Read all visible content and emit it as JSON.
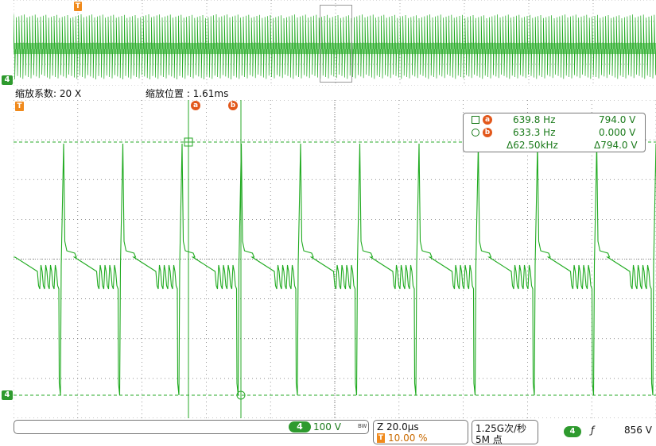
{
  "overview": {
    "channel_marker": "4",
    "trigger_marker": "T"
  },
  "zoom_info": {
    "zoom_factor_label": "缩放系数: 20 X",
    "zoom_position_label": "缩放位置 : 1.61ms"
  },
  "main_plot": {
    "channel_marker": "4",
    "trigger_marker": "T",
    "cursor_a_label": "a",
    "cursor_b_label": "b"
  },
  "readout": {
    "cursor_a": {
      "badge": "a",
      "freq": "639.8 Hz",
      "volt": "794.0 V"
    },
    "cursor_b": {
      "badge": "b",
      "freq": "633.3 Hz",
      "volt": "0.000 V"
    },
    "delta": {
      "freq": "Δ62.50kHz",
      "volt": "Δ794.0 V"
    }
  },
  "status": {
    "channel": "4",
    "channel_scale": "100 V",
    "bandwidth_flag": "BW",
    "timebase": "Z 20.0µs",
    "trigger_position": "10.00 %",
    "sample_rate": "1.25G次/秒",
    "record_length": "5M 点",
    "trigger_source": "4",
    "trigger_slope": "ƒ",
    "trigger_level": "856 V"
  },
  "colors": {
    "trace": "#1faa1f",
    "grid": "#6a6a6a",
    "cursor": "#27a827",
    "trigger": "#f08a1c",
    "cursor_badge": "#e2571b",
    "channel_badge": "#2e9a2e"
  }
}
